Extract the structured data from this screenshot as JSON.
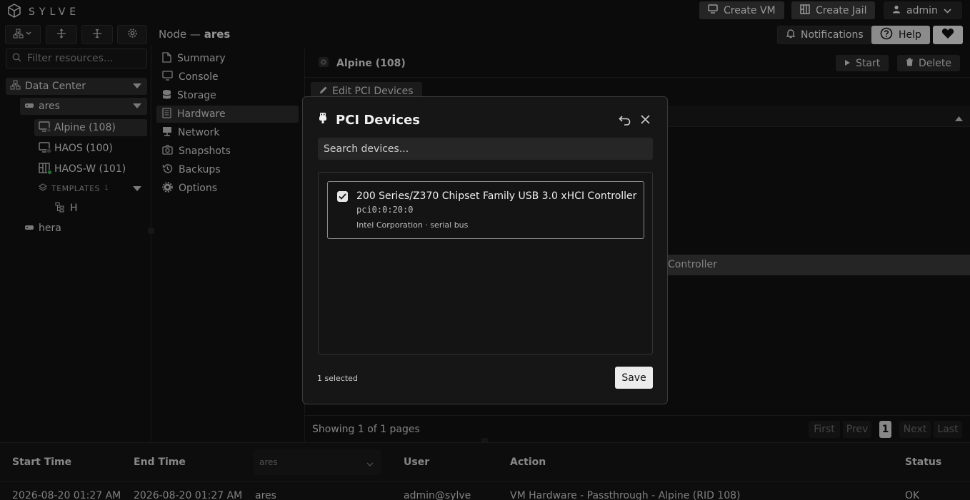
{
  "topbar": {
    "brand": "SYLVE",
    "create_vm": "Create VM",
    "create_jail": "Create Jail",
    "user": "admin"
  },
  "toolbar": {
    "notifications": "Notifications",
    "help": "Help"
  },
  "breadcrumb": {
    "prefix": "Node —",
    "node": "ares"
  },
  "tree": {
    "filter_placeholder": "Filter resources...",
    "datacenter": "Data Center",
    "nodes": [
      {
        "name": "ares",
        "items": [
          {
            "label": "Alpine (108)",
            "status": "stopped"
          },
          {
            "label": "HAOS (100)",
            "status": "stopped"
          },
          {
            "label": "HAOS-W (101)",
            "status": "running"
          }
        ],
        "templates": {
          "label": "TEMPLATES",
          "count": "1",
          "items": [
            "H"
          ]
        }
      },
      {
        "name": "hera"
      }
    ]
  },
  "nav": {
    "items": [
      "Summary",
      "Console",
      "Storage",
      "Hardware",
      "Network",
      "Snapshots",
      "Backups",
      "Options"
    ],
    "selected": "Hardware"
  },
  "content": {
    "vm_title": "Alpine (108)",
    "start": "Start",
    "delete": "Delete",
    "edit_pci": "Edit PCI Devices",
    "row_text": "Controller",
    "pager": {
      "info": "Showing 1 of 1 pages",
      "first": "First",
      "prev": "Prev",
      "current": "1",
      "next": "Next",
      "last": "Last"
    }
  },
  "log": {
    "headers": [
      "Start Time",
      "End Time",
      "ares",
      "User",
      "Action",
      "Status"
    ],
    "row": [
      "2026-08-20 01:27 AM",
      "2026-08-20 01:27 AM",
      "ares",
      "admin@sylve",
      "VM Hardware - Passthrough - Alpine (RID 108)",
      "OK"
    ]
  },
  "modal": {
    "title": "PCI Devices",
    "search_placeholder": "Search devices...",
    "devices": [
      {
        "name": "200 Series/Z370 Chipset Family USB 3.0 xHCI Controller",
        "address": "pci0:0:20:0",
        "vendor": "Intel Corporation · serial bus",
        "checked": true
      }
    ],
    "selected_count": "1 selected",
    "save": "Save"
  },
  "colors": {
    "accent": "#2fae4f",
    "background": "#111111",
    "modal_bg": "#161616"
  }
}
